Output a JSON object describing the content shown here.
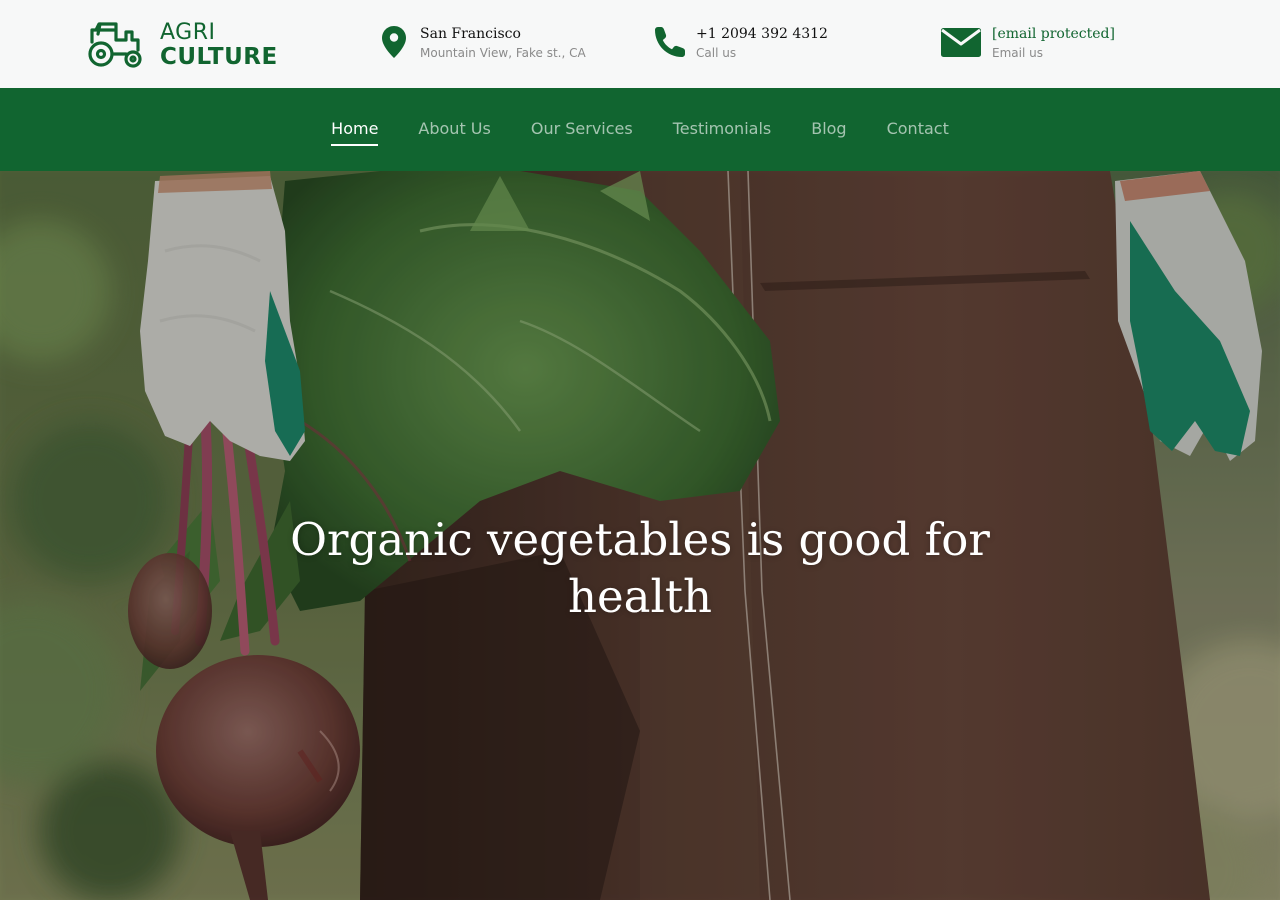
{
  "brand": {
    "line1": "AGRI",
    "line2": "CULTURE",
    "color": "#116530",
    "icon": "tractor-icon"
  },
  "contacts": [
    {
      "icon": "map-pin-icon",
      "title": "San Francisco",
      "subtitle": "Mountain View, Fake st., CA"
    },
    {
      "icon": "phone-icon",
      "title": "+1 2094 392 4312",
      "subtitle": "Call us"
    },
    {
      "icon": "envelope-icon",
      "title": "[email protected]",
      "subtitle": "Email us"
    }
  ],
  "nav": {
    "items": [
      {
        "label": "Home",
        "active": true
      },
      {
        "label": "About Us",
        "active": false
      },
      {
        "label": "Our Services",
        "active": false
      },
      {
        "label": "Testimonials",
        "active": false
      },
      {
        "label": "Blog",
        "active": false
      },
      {
        "label": "Contact",
        "active": false
      }
    ]
  },
  "hero": {
    "title": "Organic vegetables is good for health"
  },
  "colors": {
    "primary_green": "#116530",
    "topbar_bg": "#f7f8f8"
  }
}
